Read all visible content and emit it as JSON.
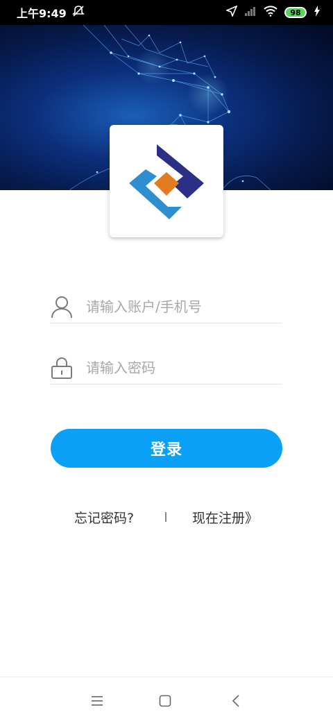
{
  "status_bar": {
    "time": "上午9:49",
    "battery": "98",
    "icons": [
      "dnd-icon",
      "location-icon",
      "signal-icon",
      "wifi-icon",
      "battery-icon",
      "charging-icon"
    ]
  },
  "banner": {
    "icon": "hand-network-illustration"
  },
  "logo": {
    "icon": "app-logo",
    "colors": [
      "#2c2f86",
      "#2e8fd0",
      "#e47b1f"
    ]
  },
  "login_form": {
    "account_placeholder": "请输入账户/手机号",
    "account_value": "",
    "account_icon": "user-icon",
    "password_placeholder": "请输入密码",
    "password_value": "",
    "password_icon": "lock-icon",
    "login_label": "登录"
  },
  "links": {
    "forgot_password": "忘记密码?",
    "register": "现在注册》"
  },
  "nav_bar": {
    "icons": [
      "menu-icon",
      "home-icon",
      "back-icon"
    ]
  },
  "colors": {
    "accent": "#0aa0f5",
    "status_bar": "#000000"
  }
}
